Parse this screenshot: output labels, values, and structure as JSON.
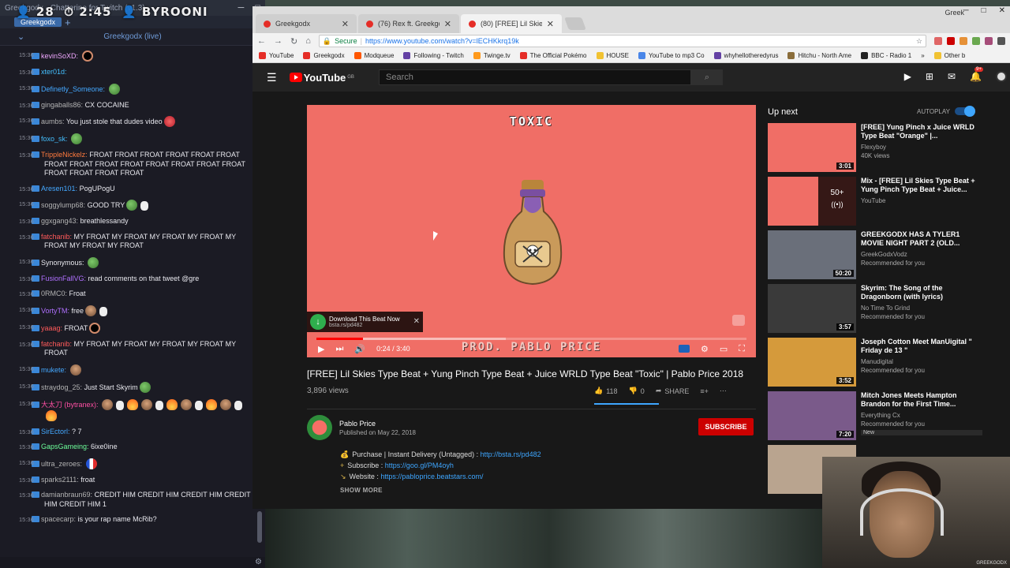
{
  "chat_app": {
    "window_title": "Greekgodx - Chatterino for Twitch (v1.3)",
    "overlay_viewers": "28",
    "overlay_time": "2:45",
    "overlay_name": "BYROONI",
    "tab_label": "Greekgodx",
    "tab_add": "+",
    "channel_label": "Greekgodx (live)",
    "messages": [
      {
        "ts": "15:36",
        "user": "kevinSoXD:",
        "color": "#f0a8ff",
        "text": "",
        "emotes": [
          "ring"
        ]
      },
      {
        "ts": "15:36",
        "user": "xter01d:",
        "color": "#44c0ff",
        "text": "",
        "emotes": []
      },
      {
        "ts": "15:36",
        "user": "Definetly_Someone:",
        "color": "#44a8ff",
        "text": "",
        "emotes": [
          "pepe"
        ]
      },
      {
        "ts": "15:36",
        "user": "gingaballs86:",
        "color": "#b3b3b3",
        "text": "CX COCAINE",
        "emotes": []
      },
      {
        "ts": "15:36",
        "user": "aumbs:",
        "color": "#b3b3b3",
        "text": "You just stole that dudes video",
        "emotes": [
          "angry"
        ]
      },
      {
        "ts": "15:36",
        "user": "foxo_sk:",
        "color": "#44c0ff",
        "text": "",
        "emotes": [
          "pepe"
        ]
      },
      {
        "ts": "15:36",
        "user": "TrippleNickelz:",
        "color": "#ff7a3d",
        "text": "FROAT FROAT FROAT FROAT FROAT FROAT FROAT FROAT FROAT FROAT FROAT FROAT FROAT FROAT FROAT FROAT FROAT FROAT",
        "emotes": []
      },
      {
        "ts": "15:36",
        "user": "Aresen101:",
        "color": "#44a8ff",
        "text": "PogUPogU",
        "emotes": []
      },
      {
        "ts": "15:36",
        "user": "soggylump68:",
        "color": "#b3b3b3",
        "text": "GOOD TRY",
        "emotes": [
          "pepe",
          "hands"
        ]
      },
      {
        "ts": "15:36",
        "user": "ggxgang43:",
        "color": "#b3b3b3",
        "text": "breathlessandy",
        "emotes": []
      },
      {
        "ts": "15:36",
        "user": "fatchanib:",
        "color": "#ff5a5a",
        "text": "MY FROAT MY FROAT MY FROAT MY FROAT MY FROAT MY FROAT MY FROAT",
        "emotes": []
      },
      {
        "ts": "15:36",
        "user": "Synonymous:",
        "color": "#e8e8ee",
        "text": "",
        "emotes": [
          "pepe"
        ]
      },
      {
        "ts": "15:36",
        "user": "FusionFallVG:",
        "color": "#b070ff",
        "text": "read comments on that tweet @gre",
        "emotes": []
      },
      {
        "ts": "15:36",
        "user": "0RMC0:",
        "color": "#b3b3b3",
        "text": "Froat",
        "emotes": []
      },
      {
        "ts": "15:36",
        "user": "VortyTM:",
        "color": "#b070ff",
        "text": "free",
        "emotes": [
          "face",
          "hands"
        ]
      },
      {
        "ts": "15:36",
        "user": "yaaag:",
        "color": "#ff5a5a",
        "text": "FROAT",
        "emotes": [
          "ring"
        ]
      },
      {
        "ts": "15:36",
        "user": "fatchanib:",
        "color": "#ff5a5a",
        "text": "MY FROAT MY FROAT MY FROAT MY FROAT MY FROAT",
        "emotes": []
      },
      {
        "ts": "15:36",
        "user": "mukete:",
        "color": "#44a8ff",
        "text": "",
        "emotes": [
          "face"
        ]
      },
      {
        "ts": "15:36",
        "user": "straydog_25:",
        "color": "#b3b3b3",
        "text": "Just Start Skyrim",
        "emotes": [
          "pepe"
        ]
      },
      {
        "ts": "15:36",
        "user": "大太刀 (bytranex):",
        "color": "#ff4fa3",
        "text": "",
        "emotes": [
          "face",
          "hands",
          "fire",
          "face",
          "hands",
          "fire",
          "face",
          "hands",
          "fire",
          "face",
          "hands",
          "fire"
        ]
      },
      {
        "ts": "15:36",
        "user": "SirEctorl:",
        "color": "#44a8ff",
        "text": "? 7",
        "emotes": []
      },
      {
        "ts": "15:36",
        "user": "GapsGameing:",
        "color": "#6dff9a",
        "text": "6ixe0ine",
        "emotes": []
      },
      {
        "ts": "15:36",
        "user": "ultra_zeroes:",
        "color": "#b3b3b3",
        "text": "",
        "emotes": [
          "flag"
        ]
      },
      {
        "ts": "15:36",
        "user": "sparks2111:",
        "color": "#b3b3b3",
        "text": "froat",
        "emotes": []
      },
      {
        "ts": "15:36",
        "user": "damianbraun69:",
        "color": "#b3b3b3",
        "text": "CREDIT HIM CREDIT HIM CREDIT HIM CREDIT HIM CREDIT HIM 1",
        "emotes": []
      },
      {
        "ts": "15:36",
        "user": "spacecarp:",
        "color": "#b3b3b3",
        "text": "is your rap name McRib?",
        "emotes": []
      }
    ]
  },
  "browser": {
    "profile_name": "Greek",
    "tabs": [
      {
        "title": "Greekgodx",
        "color": "#e52d27",
        "active": false
      },
      {
        "title": "(76) Rex ft. Greekgodx -",
        "color": "#e52d27",
        "active": false
      },
      {
        "title": "(80) [FREE] Lil Skies Ty",
        "color": "#e52d27",
        "active": true
      }
    ],
    "secure_label": "Secure",
    "url": "https://www.youtube.com/watch?v=lECHKkrq19k",
    "bookmarks": [
      {
        "label": "YouTube",
        "color": "#e52d27"
      },
      {
        "label": "Greekgodx",
        "color": "#e52d27"
      },
      {
        "label": "Modqueue",
        "color": "#ff5700"
      },
      {
        "label": "Following - Twitch",
        "color": "#6441a4"
      },
      {
        "label": "Twinge.tv",
        "color": "#ff9a1c"
      },
      {
        "label": "The Official Pokémo",
        "color": "#e52d27"
      },
      {
        "label": "HOUSE",
        "color": "#f1c232"
      },
      {
        "label": "YouTube to mp3 Co",
        "color": "#4a86e8"
      },
      {
        "label": "whyhellotheredyrus",
        "color": "#6441a4"
      },
      {
        "label": "Hitchu - North Ame",
        "color": "#8a6d3b"
      },
      {
        "label": "BBC - Radio 1",
        "color": "#222222"
      }
    ],
    "other_bookmarks": "Other b"
  },
  "youtube": {
    "search_placeholder": "Search",
    "logo_text": "YouTube",
    "logo_country": "GB",
    "notifications": "9+",
    "player": {
      "overlay_title": "TOXIC",
      "download_title": "Download This Beat Now",
      "download_link": "bsta.rs/pd482",
      "time": "0:24 / 3:40",
      "prod_text": "PROD. PABLO PRICE",
      "progress_played": 0.109,
      "progress_buffered": 0.44
    },
    "video_title": "[FREE] Lil Skies Type Beat + Yung Pinch Type Beat + Juice WRLD Type Beat \"Toxic\" | Pablo Price 2018",
    "views": "3,896 views",
    "likes": "118",
    "dislikes": "0",
    "like_ratio": 1.0,
    "share_label": "SHARE",
    "channel": "Pablo Price",
    "published": "Published on May 22, 2018",
    "subscribe_label": "SUBSCRIBE",
    "description": [
      {
        "prefix": "Purchase | Instant Delivery (Untagged) : ",
        "link": "http://bsta.rs/pd482"
      },
      {
        "prefix": "Subscribe : ",
        "link": "https://goo.gl/PM4oyh"
      },
      {
        "prefix": "Website : ",
        "link": "https://pabloprice.beatstars.com/"
      }
    ],
    "show_more": "SHOW MORE",
    "up_next_label": "Up next",
    "autoplay_label": "AUTOPLAY",
    "recommendations": [
      {
        "title": "[FREE] Yung Pinch x Juice WRLD Type Beat \"Orange\" |...",
        "channel": "Flexyboy",
        "meta": "40K views",
        "duration": "3:01",
        "thumb": "#f06e66",
        "mix": false,
        "is_new": false
      },
      {
        "title": "Mix - [FREE] Lil Skies Type Beat + Yung Pinch Type Beat + Juice...",
        "channel": "YouTube",
        "meta": "",
        "duration": "",
        "thumb": "#f06e66",
        "mix": true,
        "mix_count": "50+",
        "is_new": false
      },
      {
        "title": "GREEKGODX HAS A TYLER1 MOVIE NIGHT PART 2 (OLD...",
        "channel": "GreekGodxVodz",
        "meta": "Recommended for you",
        "duration": "50:20",
        "thumb": "#6a6f7a",
        "mix": false,
        "is_new": false
      },
      {
        "title": "Skyrim: The Song of the Dragonborn (with lyrics)",
        "channel": "No Time To Grind",
        "meta": "Recommended for you",
        "duration": "3:57",
        "thumb": "#3a3a3a",
        "mix": false,
        "is_new": false
      },
      {
        "title": "Joseph Cotton Meet ManUigital \" Friday de 13 \"",
        "channel": "Manudigital",
        "meta": "Recommended for you",
        "duration": "3:52",
        "thumb": "#d59a3b",
        "mix": false,
        "is_new": false
      },
      {
        "title": "Mitch Jones Meets Hampton Brandon for the First Time...",
        "channel": "Everything Cx",
        "meta": "Recommended for you",
        "duration": "7:20",
        "thumb": "#7a5a8a",
        "mix": false,
        "is_new": true,
        "new_label": "New"
      },
      {
        "title": "",
        "channel": "",
        "meta": "",
        "duration": "",
        "thumb": "#b9a48f",
        "mix": false,
        "is_new": false
      }
    ]
  },
  "webcam": {
    "watermark": "GREEKGODX"
  }
}
